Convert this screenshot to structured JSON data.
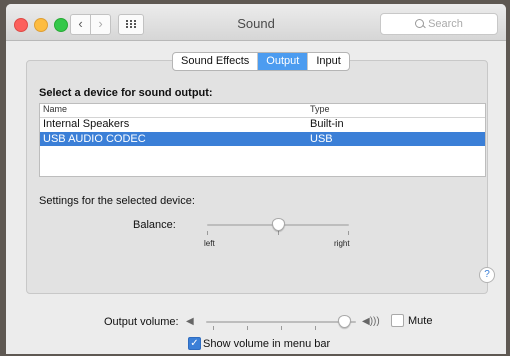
{
  "window": {
    "title": "Sound",
    "search_placeholder": "Search",
    "nav": {
      "back": "‹",
      "forward": "›"
    }
  },
  "tabs": [
    {
      "label": "Sound Effects",
      "active": false
    },
    {
      "label": "Output",
      "active": true
    },
    {
      "label": "Input",
      "active": false
    }
  ],
  "output": {
    "heading": "Select a device for sound output:",
    "columns": [
      "Name",
      "Type"
    ],
    "devices": [
      {
        "name": "Internal Speakers",
        "type": "Built-in",
        "selected": false
      },
      {
        "name": "USB AUDIO  CODEC",
        "type": "USB",
        "selected": true
      }
    ],
    "settings_label": "Settings for the selected device:",
    "balance": {
      "label": "Balance:",
      "left_label": "left",
      "right_label": "right",
      "value": 0.5
    }
  },
  "volume": {
    "label": "Output volume:",
    "value": 0.92,
    "mute_label": "Mute",
    "muted": false,
    "show_in_menu_bar_label": "Show volume in menu bar",
    "show_in_menu_bar": true
  },
  "icons": {
    "speaker_low": "◀",
    "speaker_high": "◀)))",
    "help": "?",
    "check": "✓"
  },
  "colors": {
    "accent": "#3b7fd7",
    "tab_active": "#4c9cf0",
    "desktop": "#5e5852"
  }
}
